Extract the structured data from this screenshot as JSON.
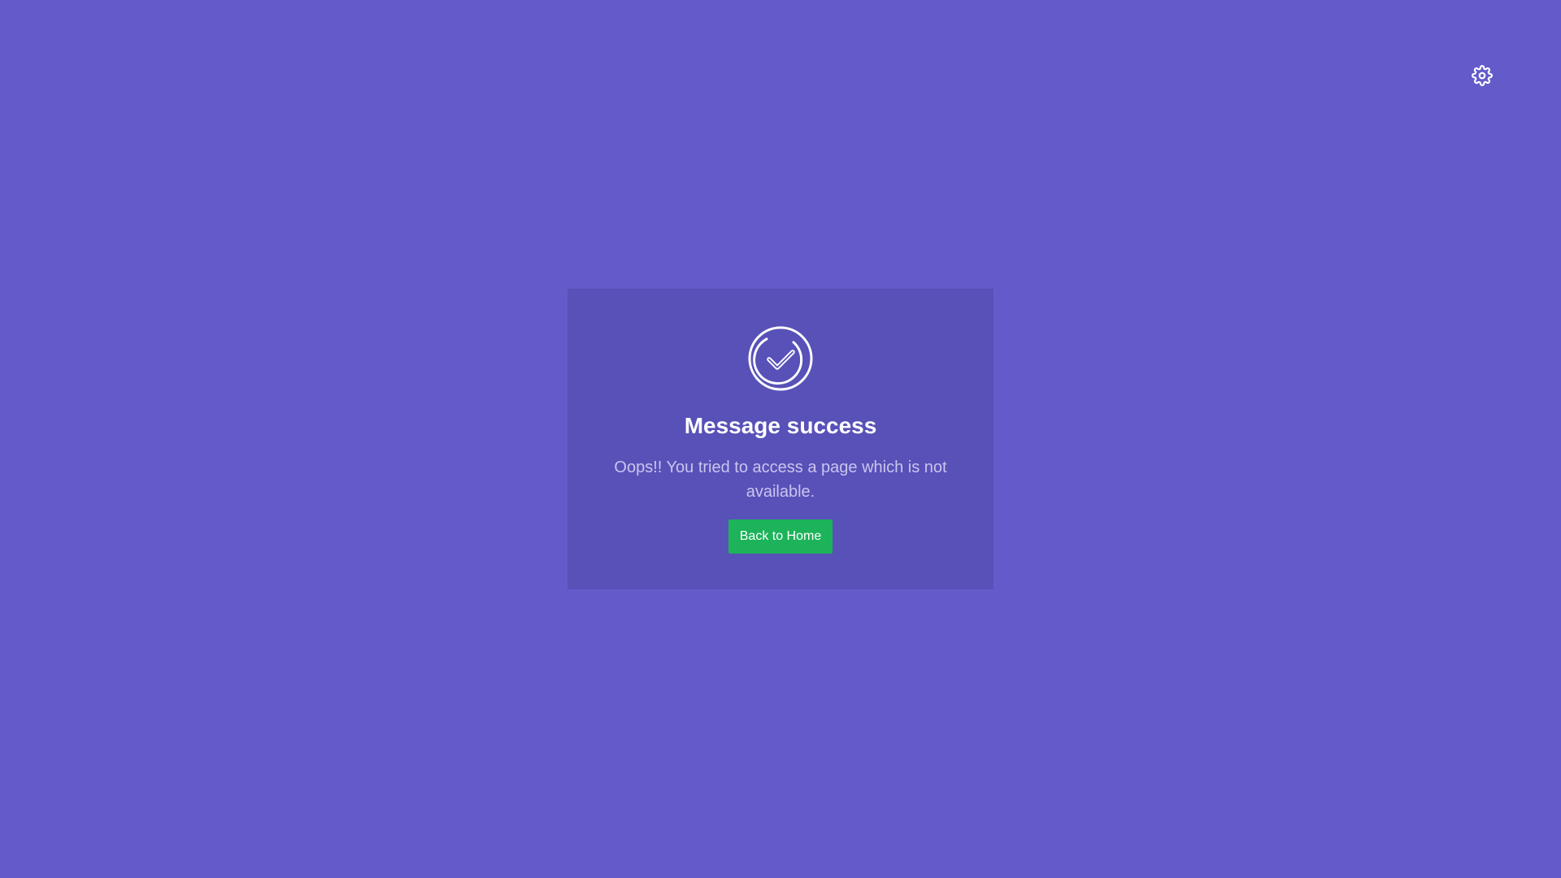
{
  "settings": {
    "icon": "gear-icon"
  },
  "card": {
    "icon": "check-circle-icon",
    "title": "Message success",
    "message": "Oops!! You tried to access a page which is not available.",
    "button_label": "Back to Home"
  },
  "colors": {
    "background": "#645bca",
    "card": "#5851b8",
    "button": "#1cb35a",
    "text_primary": "#ffffff",
    "text_secondary": "#c9c5ee"
  }
}
